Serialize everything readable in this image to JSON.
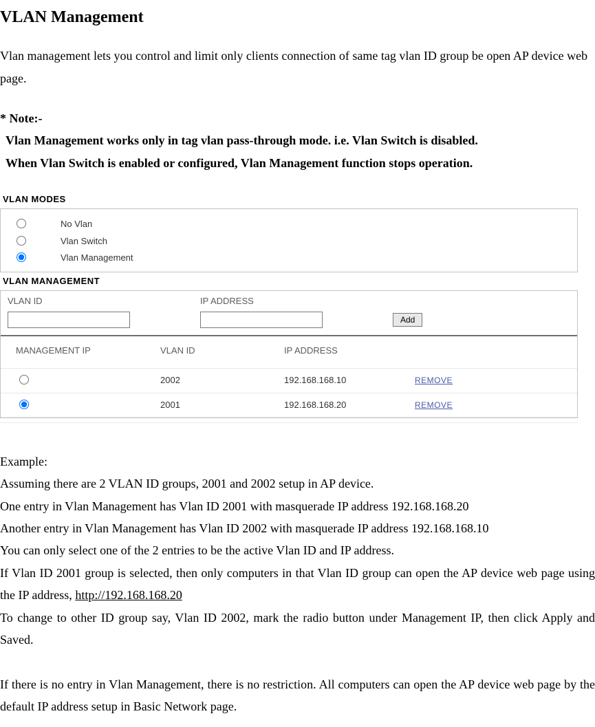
{
  "title": "VLAN Management",
  "intro": "Vlan management lets you control and limit only clients connection of same tag vlan ID group be open AP device web page.",
  "note": {
    "label": "* Note:-",
    "line1": "Vlan Management works only in tag vlan pass-through mode. i.e. Vlan Switch is disabled.",
    "line2": "When Vlan Switch is enabled or configured, Vlan Management function stops operation."
  },
  "panel": {
    "modes_header": "VLAN MODES",
    "modes": {
      "opt1": "No Vlan",
      "opt2": "Vlan Switch",
      "opt3": "Vlan Management",
      "selected": "opt3"
    },
    "mgmt_header": "VLAN MANAGEMENT",
    "add": {
      "vlan_label": "VLAN ID",
      "ip_label": "IP ADDRESS",
      "vlan_value": "",
      "ip_value": "",
      "button": "Add"
    },
    "table": {
      "col_mgmt": "MANAGEMENT IP",
      "col_vlan": "VLAN ID",
      "col_ip": "IP ADDRESS",
      "rows": [
        {
          "selected": false,
          "vlan": "2002",
          "ip": "192.168.168.10",
          "action": "REMOVE"
        },
        {
          "selected": true,
          "vlan": "2001",
          "ip": "192.168.168.20",
          "action": "REMOVE"
        }
      ]
    }
  },
  "example": {
    "label": "Example:",
    "p1": "Assuming there are 2 VLAN ID groups, 2001 and 2002 setup in AP device.",
    "p2": "One entry in Vlan Management has Vlan ID 2001 with masquerade IP address 192.168.168.20",
    "p3": "Another entry in Vlan Management has Vlan ID 2002 with masquerade IP address 192.168.168.10",
    "p4": "You can only select one of the 2 entries to be the active Vlan ID and IP address.",
    "p5a": "If Vlan ID 2001 group is selected, then only computers in that Vlan ID group can open the AP device web page using the IP address, ",
    "p5link": "http://192.168.168.20",
    "p6": "To change to other ID group say, Vlan ID 2002, mark the radio button under Management IP, then click Apply and Saved.",
    "p7": "If there is no entry in Vlan Management, there is no restriction. All computers can open the AP device web page by the default IP address setup in Basic Network page."
  }
}
